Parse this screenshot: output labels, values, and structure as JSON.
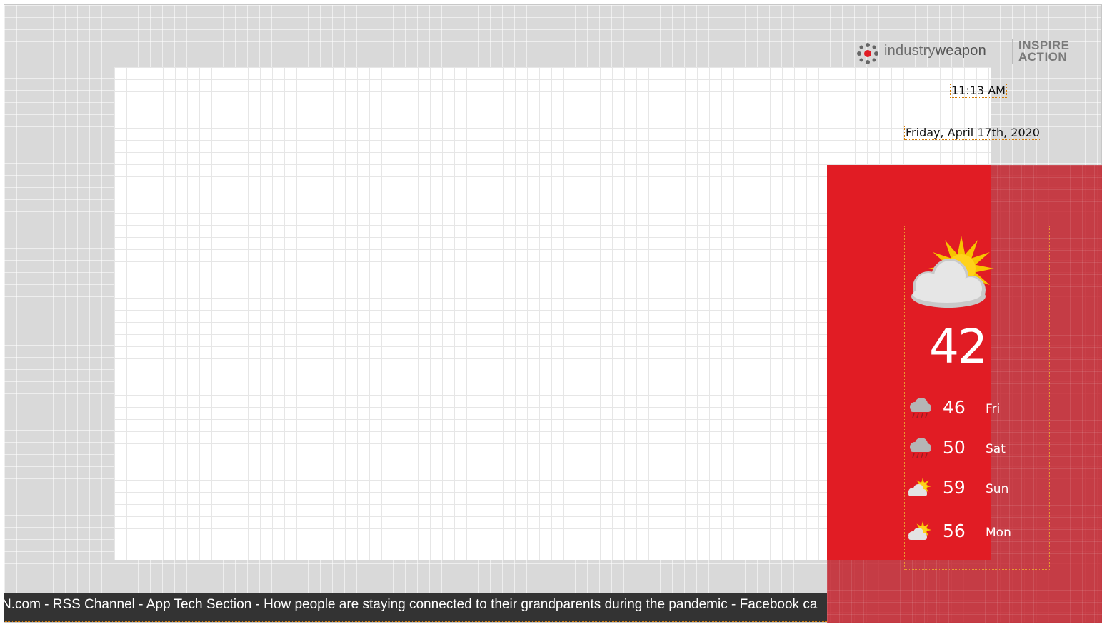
{
  "brand": {
    "logo_icon": "industryweapon-logo-icon",
    "name_light": "industry",
    "name_bold": "weapon",
    "tagline_line1": "INSPIRE",
    "tagline_line2": "ACTION",
    "accent_color": "#e11c24"
  },
  "clock": {
    "time": "11:13 AM",
    "date": "Friday, April 17th, 2020"
  },
  "weather": {
    "current_icon": "partly-sunny-cloud-icon",
    "current_temp": "42",
    "forecast": [
      {
        "icon": "rain-cloud-icon",
        "temp": "46",
        "day": "Fri"
      },
      {
        "icon": "rain-cloud-icon",
        "temp": "50",
        "day": "Sat"
      },
      {
        "icon": "partly-sunny-icon",
        "temp": "59",
        "day": "Sun"
      },
      {
        "icon": "partly-sunny-icon",
        "temp": "56",
        "day": "Mon"
      }
    ],
    "panel_color": "#e11c24"
  },
  "ticker": {
    "text": "N.com - RSS Channel - App Tech Section - How people are staying connected to their grandparents during the pandemic - Facebook ca"
  }
}
